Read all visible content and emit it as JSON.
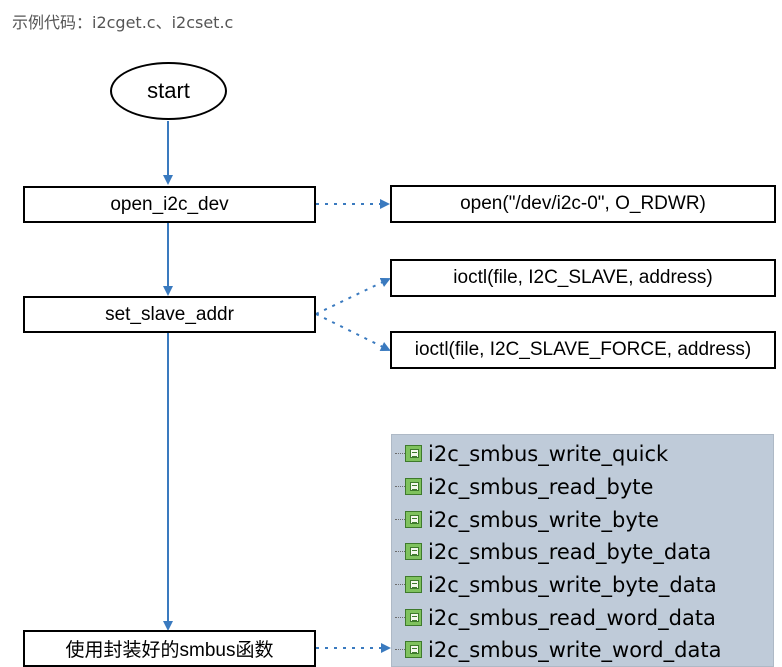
{
  "caption": "示例代码：i2cget.c、i2cset.c",
  "flow": {
    "start_label": "start",
    "step_open": "open_i2c_dev",
    "step_set_addr": "set_slave_addr",
    "step_smbus": "使用封装好的smbus函数"
  },
  "calls": {
    "open_call": "open(\"/dev/i2c-0\", O_RDWR)",
    "ioctl_slave": "ioctl(file, I2C_SLAVE, address)",
    "ioctl_slave_force": "ioctl(file, I2C_SLAVE_FORCE, address)"
  },
  "smbus_functions": [
    {
      "name": "i2c_smbus_write_quick",
      "icon": "function-icon"
    },
    {
      "name": "i2c_smbus_read_byte",
      "icon": "function-icon"
    },
    {
      "name": "i2c_smbus_write_byte",
      "icon": "function-icon"
    },
    {
      "name": "i2c_smbus_read_byte_data",
      "icon": "function-icon"
    },
    {
      "name": "i2c_smbus_write_byte_data",
      "icon": "function-icon"
    },
    {
      "name": "i2c_smbus_read_word_data",
      "icon": "function-icon"
    },
    {
      "name": "i2c_smbus_write_word_data",
      "icon": "function-icon"
    }
  ],
  "colors": {
    "flow_arrow": "#3a7abf",
    "panel_background": "#bfcbd9",
    "icon_green": "#7fc25e"
  }
}
